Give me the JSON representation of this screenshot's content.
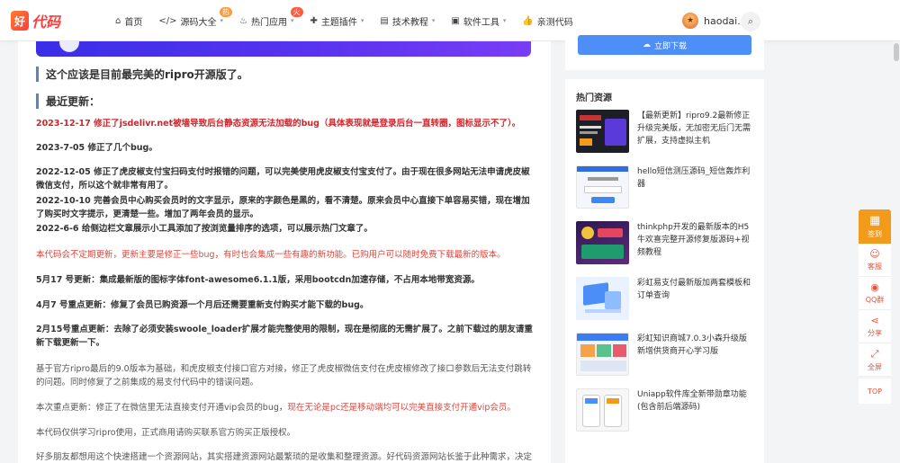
{
  "header": {
    "logo_mark": "好",
    "logo_text_a": "代码",
    "nav": [
      {
        "icon": "home-icon",
        "glyph": "⌂",
        "label": "首页",
        "badge": ""
      },
      {
        "icon": "code-icon",
        "glyph": "</>",
        "label": "源码大全",
        "badge": "热"
      },
      {
        "icon": "flame-icon",
        "glyph": "♨",
        "label": "热门应用",
        "badge": "火"
      },
      {
        "icon": "puzzle-icon",
        "glyph": "✚",
        "label": "主题插件",
        "badge": ""
      },
      {
        "icon": "book-icon",
        "glyph": "▤",
        "label": "技术教程",
        "badge": ""
      },
      {
        "icon": "briefcase-icon",
        "glyph": "▣",
        "label": "软件工具",
        "badge": ""
      },
      {
        "icon": "thumbs-up-icon",
        "glyph": "👍",
        "label": "亲测代码",
        "badge": ""
      }
    ],
    "username": "haodai...",
    "avatar_glyph": "★"
  },
  "article": {
    "lead": "这个应该是目前最完美的ripro开源版了。",
    "heading": "最近更新：",
    "p1": "2023-12-17 修正了jsdelivr.net被墙导致后台静态资源无法加载的bug（具体表现就是登录后台一直转圈，图标显示不了）。",
    "p2": "2023-7-05 修正了几个bug。",
    "p3": "2022-12-05 修正了虎皮椒支付宝扫码支付时报错的问题，可以完美使用虎皮椒支付宝支付了。由于现在很多网站无法申请虎皮椒微信支付，所以这个就非常有用了。",
    "p4": "2022-10-10 完善会员中心购买会员时的文字显示，原来的字颜色是黑的，看不清楚。原来会员中心直接下单容易买错，现在增加了购买时文字提示，更清楚一些。增加了两年会员的显示。",
    "p5": "2022-6-6 给侧边栏文章展示小工具添加了按浏览量排序的选项，可以展示热门文章了。",
    "p6": "本代码会不定期更新，更新主要是修正一些bug，有时也会集成一些有趣的新功能。已购用户可以随时免费下载最新的版本。",
    "p7": "5月17 号更新：集成最新版的图标字体font-awesome6.1.1版，采用bootcdn加速存储，不占用本地带宽资源。",
    "p8": "4月7 号重点更新：修复了会员已购资源一个月后还需要重新支付购买才能下载的bug。",
    "p9": "2月15号重点更新：去除了必须安装swoole_loader扩展才能完整使用的限制，现在是彻底的无需扩展了。之前下载过的朋友请重新下载更新一下。",
    "p10": "基于官方ripro最后的9.0版本为基础，和虎皮椒支付接口官方对接，修正了虎皮椒微信支付在虎皮椒修改了接口参数后无法支付跳转的问题。同时修复了之前集成的易支付代码中的错误问题。",
    "p11a": "本次重点更新：修正了在微信里无法直接支付开通vip会员的bug，",
    "p11b": "现在无论是pc还是移动端均可以完美直接支付开通vip会员。",
    "p12": "本代码仅供学习ripro使用，正式商用请购买联系官方购买正版授权。",
    "p13": "好多朋友都想用这个快速搭建一个资源网站，其实搭建资源网站最繁琐的是收集和整理资源。好代码资源网站长鉴于此种需求，决定把本站到"
  },
  "sidebar": {
    "download_label": "立即下载",
    "hot_title": "热门资源",
    "hot_items": [
      {
        "title": "【最新更新】ripro9.2最新修正升级完美版，无加密无后门无需扩展，支持虚拟主机"
      },
      {
        "title": "hello短信测压源码_短信轰炸利器"
      },
      {
        "title": "thinkphp开发的最新版本的H5牛欢喜完整开源修复版源码+视频教程"
      },
      {
        "title": "彩虹易支付最新版加两套模板和订单查询"
      },
      {
        "title": "彩虹知识商城7.0.3小森升级版新增供货商开心学习版"
      },
      {
        "title": "Uniapp软件库全新带勋章功能(包含前后端源码)"
      }
    ]
  },
  "float": {
    "sign": "签到",
    "service": "客服",
    "qq": "QQ群",
    "share": "分享",
    "fullscreen": "全屏",
    "top": "TOP"
  }
}
